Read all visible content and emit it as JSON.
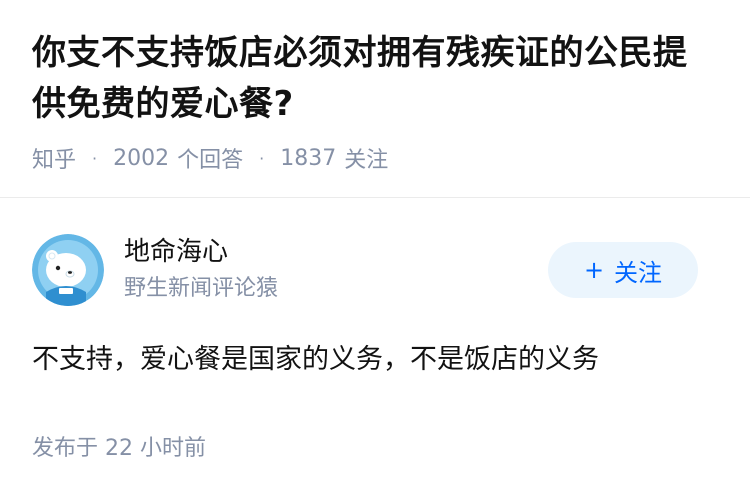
{
  "question": {
    "title": "你支不支持饭店必须对拥有残疾证的公民提供免费的爱心餐?",
    "source": "知乎",
    "answer_count": "2002",
    "answer_label": "个回答",
    "follower_count": "1837",
    "follower_label": "关注"
  },
  "answer": {
    "author_name": "地命海心",
    "author_bio": "野生新闻评论猿",
    "follow_button": "关注",
    "follow_icon": "plus-icon",
    "content": "不支持，爱心餐是国家的义务，不是饭店的义务",
    "published_prefix": "发布于",
    "published_time": "22 小时前"
  },
  "colors": {
    "accent": "#0066ff",
    "button_bg": "#ebf5fd",
    "meta_text": "#8590a6",
    "avatar_bg": "#63b7e6"
  }
}
